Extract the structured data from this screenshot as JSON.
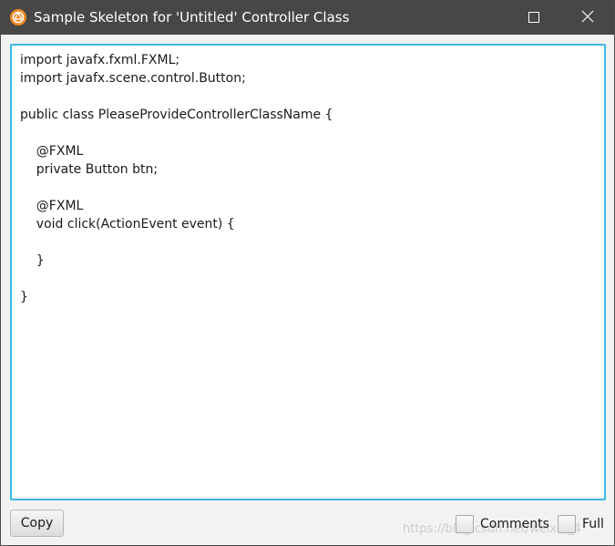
{
  "window": {
    "title": "Sample Skeleton for 'Untitled' Controller Class",
    "icons": {
      "app": "scene-builder-icon",
      "maximize": "maximize-icon",
      "close": "close-icon"
    },
    "colors": {
      "titlebar": "#474747",
      "focus_border": "#3cb8e6"
    }
  },
  "code": {
    "text": "import javafx.fxml.FXML;\nimport javafx.scene.control.Button;\n\npublic class PleaseProvideControllerClassName {\n\n    @FXML\n    private Button btn;\n\n    @FXML\n    void click(ActionEvent event) {\n\n    }\n\n}"
  },
  "footer": {
    "copy_label": "Copy",
    "comments_label": "Comments",
    "full_label": "Full",
    "comments_checked": false,
    "full_checked": false,
    "watermark": "https://blog.csdn.net/weixin_4"
  }
}
